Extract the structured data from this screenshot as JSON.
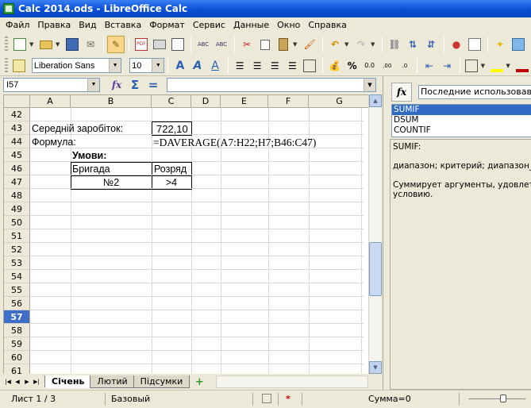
{
  "window": {
    "title": "Calc 2014.ods - LibreOffice Calc"
  },
  "menu": [
    "Файл",
    "Правка",
    "Вид",
    "Вставка",
    "Формат",
    "Сервис",
    "Данные",
    "Окно",
    "Справка"
  ],
  "toolbar2": {
    "font_name": "Liberation Sans",
    "font_size": "10"
  },
  "formula_bar": {
    "cell_ref": "I57",
    "content": ""
  },
  "columns": [
    "A",
    "B",
    "C",
    "D",
    "E",
    "F",
    "G"
  ],
  "rows": [
    "42",
    "43",
    "44",
    "45",
    "46",
    "47",
    "48",
    "49",
    "50",
    "51",
    "52",
    "53",
    "54",
    "55",
    "56",
    "57",
    "58",
    "59",
    "60",
    "61"
  ],
  "selected_row": "57",
  "cells": {
    "a43": "Середній заробіток:",
    "c43": "722,10",
    "a44": "Формула:",
    "c44": "=DAVERAGE(A7:H22;H7;B46:C47)",
    "b45": "Умови:",
    "b46": "Бригада",
    "c46": "Розряд",
    "b47": "№2",
    "c47": ">4"
  },
  "sheet_tabs": [
    "Січень",
    "Лютий",
    "Підсумки"
  ],
  "active_sheet": "Січень",
  "statusbar": {
    "sheet": "Лист 1 / 3",
    "style": "Базовый",
    "sum": "Сумма=0"
  },
  "sidebar": {
    "category": "Последние использовавшиеся",
    "functions": [
      "SUMIF",
      "DSUM",
      "COUNTIF"
    ],
    "selected_function": "SUMIF",
    "description": {
      "signature": "SUMIF:",
      "params": "диапазон; критерий; диапазон_суммирования",
      "text_line1": "Суммирует аргументы, удовлетворяющие",
      "text_line2": "условию."
    }
  },
  "icons": {
    "new": "new-document-icon",
    "open": "open-icon",
    "save": "save-icon",
    "email": "email-icon",
    "edit": "edit-file-icon",
    "pdf": "export-pdf-icon",
    "print": "print-icon",
    "preview": "print-preview-icon",
    "spell": "spellcheck-icon",
    "autospell": "autospellcheck-icon",
    "cut": "cut-icon",
    "copy": "copy-icon",
    "paste": "paste-icon",
    "clone": "clone-formatting-icon",
    "undo": "undo-icon",
    "redo": "redo-icon",
    "link": "hyperlink-icon",
    "sortasc": "sort-ascending-icon",
    "sortdesc": "sort-descending-icon",
    "chart": "chart-icon",
    "pivot": "pivot-icon",
    "star": "star-icon",
    "gallery": "gallery-icon"
  },
  "colors": {
    "titlebar": "#0a4fd6",
    "selected_row": "#3f6ec9",
    "selected_list": "#316ac5"
  }
}
